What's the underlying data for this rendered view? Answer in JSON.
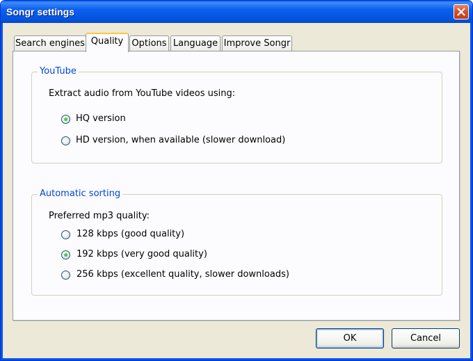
{
  "window": {
    "title": "Songr settings"
  },
  "tabs": [
    {
      "label": "Search engines",
      "active": false
    },
    {
      "label": "Quality",
      "active": true
    },
    {
      "label": "Options",
      "active": false
    },
    {
      "label": "Language",
      "active": false
    },
    {
      "label": "Improve Songr",
      "active": false
    }
  ],
  "youtube": {
    "legend": "YouTube",
    "prompt": "Extract audio from YouTube videos using:",
    "options": [
      {
        "label": "HQ version",
        "checked": true
      },
      {
        "label": "HD version, when available (slower download)",
        "checked": false
      }
    ]
  },
  "sorting": {
    "legend": "Automatic sorting",
    "prompt": "Preferred mp3 quality:",
    "options": [
      {
        "label": "128 kbps (good quality)",
        "checked": false
      },
      {
        "label": "192 kbps (very good quality)",
        "checked": true
      },
      {
        "label": "256 kbps (excellent quality, slower downloads)",
        "checked": false
      }
    ]
  },
  "buttons": {
    "ok": "OK",
    "cancel": "Cancel"
  },
  "colors": {
    "titlebar": "#0453dd",
    "legend": "#0046d5",
    "dialog_bg": "#ece9d8",
    "active_tab_accent": "#ffc83c"
  }
}
